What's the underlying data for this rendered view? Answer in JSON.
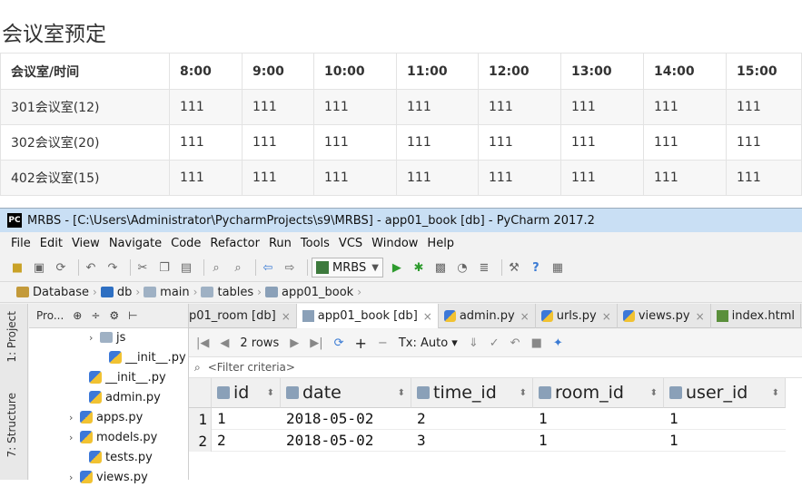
{
  "web": {
    "title": "会议室预定",
    "header": [
      "会议室/时间",
      "8:00",
      "9:00",
      "10:00",
      "11:00",
      "12:00",
      "13:00",
      "14:00",
      "15:00"
    ],
    "rows": [
      [
        "301会议室(12)",
        "111",
        "111",
        "111",
        "111",
        "111",
        "111",
        "111",
        "111"
      ],
      [
        "302会议室(20)",
        "111",
        "111",
        "111",
        "111",
        "111",
        "111",
        "111",
        "111"
      ],
      [
        "402会议室(15)",
        "111",
        "111",
        "111",
        "111",
        "111",
        "111",
        "111",
        "111"
      ]
    ]
  },
  "ide": {
    "window_title": "MRBS - [C:\\Users\\Administrator\\PycharmProjects\\s9\\MRBS] - app01_book [db] - PyCharm 2017.2",
    "logo": "PC",
    "menu": [
      "File",
      "Edit",
      "View",
      "Navigate",
      "Code",
      "Refactor",
      "Run",
      "Tools",
      "VCS",
      "Window",
      "Help"
    ],
    "run_config": "MRBS",
    "breadcrumbs": [
      "Database",
      "db",
      "main",
      "tables",
      "app01_book"
    ],
    "side_tabs": [
      "1: Project",
      "7: Structure"
    ],
    "project_header": "Pro...",
    "tree": [
      {
        "label": "js",
        "type": "folder",
        "arrow": "›"
      },
      {
        "label": "__init__.py",
        "type": "py"
      },
      {
        "label": "__init__.py",
        "type": "py"
      },
      {
        "label": "admin.py",
        "type": "py"
      },
      {
        "label": "apps.py",
        "type": "py",
        "arrow": "›"
      },
      {
        "label": "models.py",
        "type": "py",
        "arrow": "›"
      },
      {
        "label": "tests.py",
        "type": "py"
      },
      {
        "label": "views.py",
        "type": "py",
        "arrow": "›"
      }
    ],
    "tabs": [
      {
        "label": "p01_room [db]",
        "active": false
      },
      {
        "label": "app01_book [db]",
        "active": true
      },
      {
        "label": "admin.py",
        "active": false
      },
      {
        "label": "urls.py",
        "active": false
      },
      {
        "label": "views.py",
        "active": false
      },
      {
        "label": "index.html",
        "active": false
      }
    ],
    "grid_toolbar": {
      "rows_label": "2 rows",
      "tx_label": "Tx: Auto"
    },
    "filter_placeholder": "<Filter criteria>",
    "columns": [
      "id",
      "date",
      "time_id",
      "room_id",
      "user_id"
    ],
    "records": [
      {
        "row": "1",
        "id": "1",
        "date": "2018-05-02",
        "time_id": "2",
        "room_id": "1",
        "user_id": "1"
      },
      {
        "row": "2",
        "id": "2",
        "date": "2018-05-02",
        "time_id": "3",
        "room_id": "1",
        "user_id": "1"
      }
    ]
  }
}
